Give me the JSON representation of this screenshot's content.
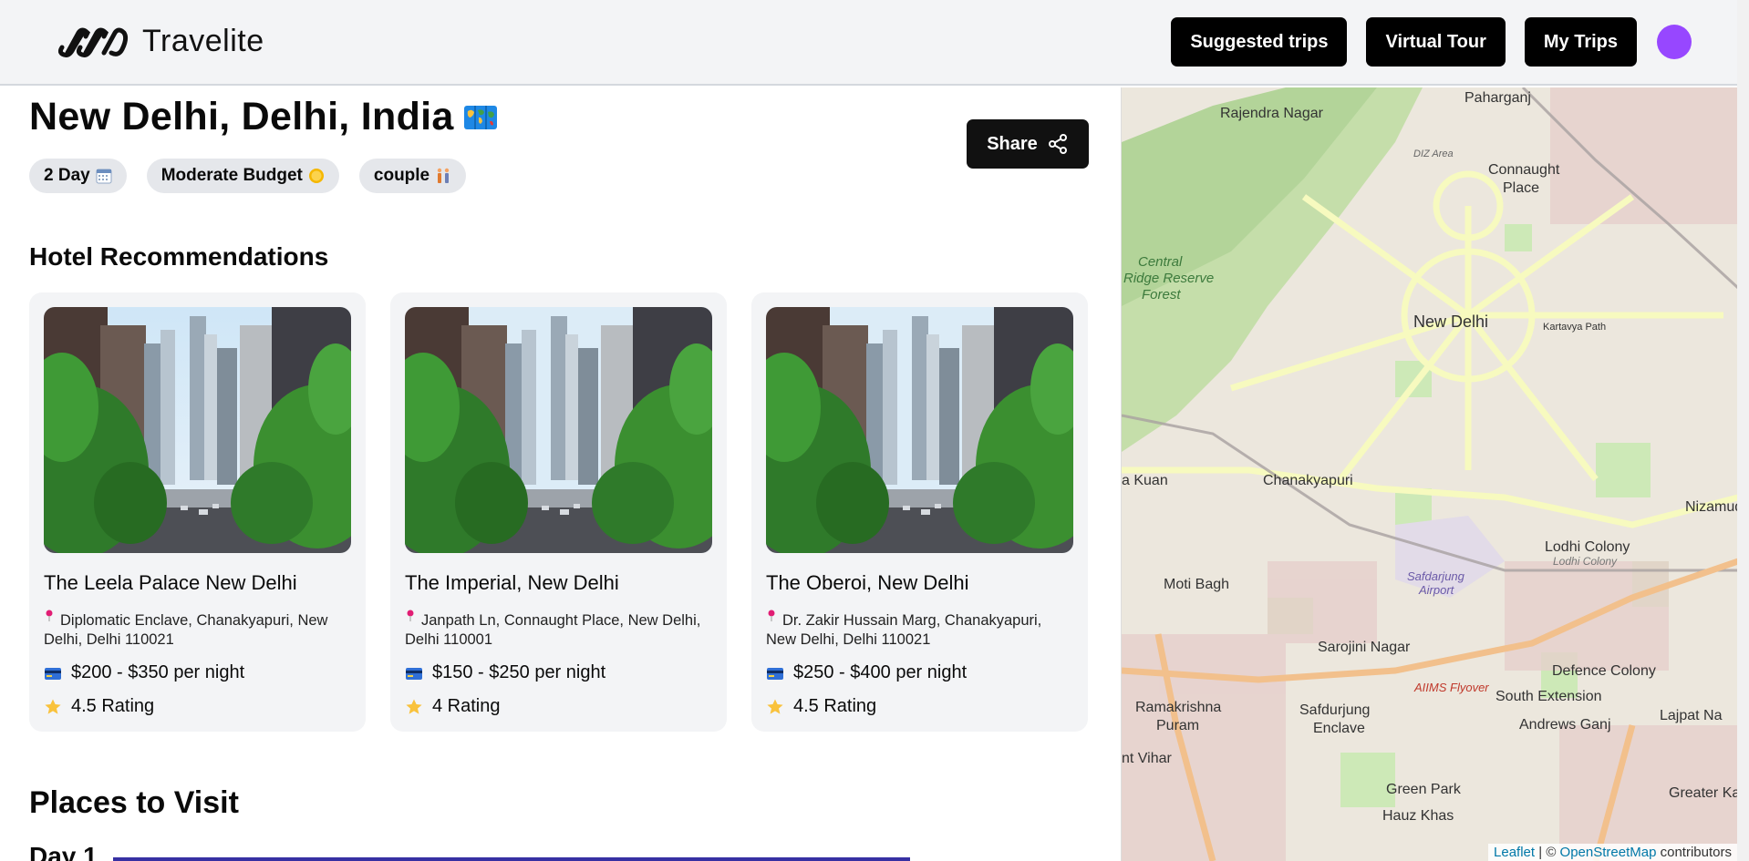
{
  "header": {
    "logo_text": "Travelite",
    "nav": [
      "Suggested trips",
      "Virtual Tour",
      "My Trips"
    ]
  },
  "trip": {
    "title": "New Delhi, Delhi, India",
    "share_label": "Share",
    "chips": [
      {
        "label": "2 Day",
        "icon": "calendar-icon"
      },
      {
        "label": "Moderate Budget",
        "icon": "coin-icon"
      },
      {
        "label": "couple",
        "icon": "couple-icon"
      }
    ]
  },
  "hotels": {
    "heading": "Hotel Recommendations",
    "items": [
      {
        "name": "The Leela Palace New Delhi",
        "address": "Diplomatic Enclave, Chanakyapuri, New Delhi, Delhi 110021",
        "price": "$200 - $350 per night",
        "rating": "4.5 Rating"
      },
      {
        "name": "The Imperial, New Delhi",
        "address": "Janpath Ln, Connaught Place, New Delhi, Delhi 110001",
        "price": "$150 - $250 per night",
        "rating": "4 Rating"
      },
      {
        "name": "The Oberoi, New Delhi",
        "address": "Dr. Zakir Hussain Marg, Chanakyapuri, New Delhi, Delhi 110021",
        "price": "$250 - $400 per night",
        "rating": "4.5 Rating"
      }
    ]
  },
  "places": {
    "heading": "Places to Visit",
    "day_label": "Day 1"
  },
  "map": {
    "labels": [
      "Rajendra Nagar",
      "Paharganj",
      "Connaught Place",
      "Central Ridge Reserve Forest",
      "New Delhi",
      "Kartavya Path",
      "Chanakyapuri",
      "Lodhi Colony",
      "Nizamuddin",
      "Moti Bagh",
      "Safdarjung Airport",
      "Sarojini Nagar",
      "AIIMS Flyover",
      "Defence Colony",
      "South Extension",
      "Lajpat Nagar",
      "Ramakrishna Puram",
      "Safdarjung Enclave",
      "Andrews Ganj",
      "Green Park",
      "Hauz Khas",
      "Greater Kailash",
      "DIZ Area",
      "a Kuan",
      "nt Vihar"
    ],
    "attribution_leaflet": "Leaflet",
    "attribution_sep": "| ©",
    "attribution_osm": "OpenStreetMap",
    "attribution_tail": "contributors"
  },
  "colors": {
    "accent": "#9747ff",
    "button": "#000000",
    "card_bg": "#f3f4f6",
    "chip_bg": "#e5e7eb"
  }
}
